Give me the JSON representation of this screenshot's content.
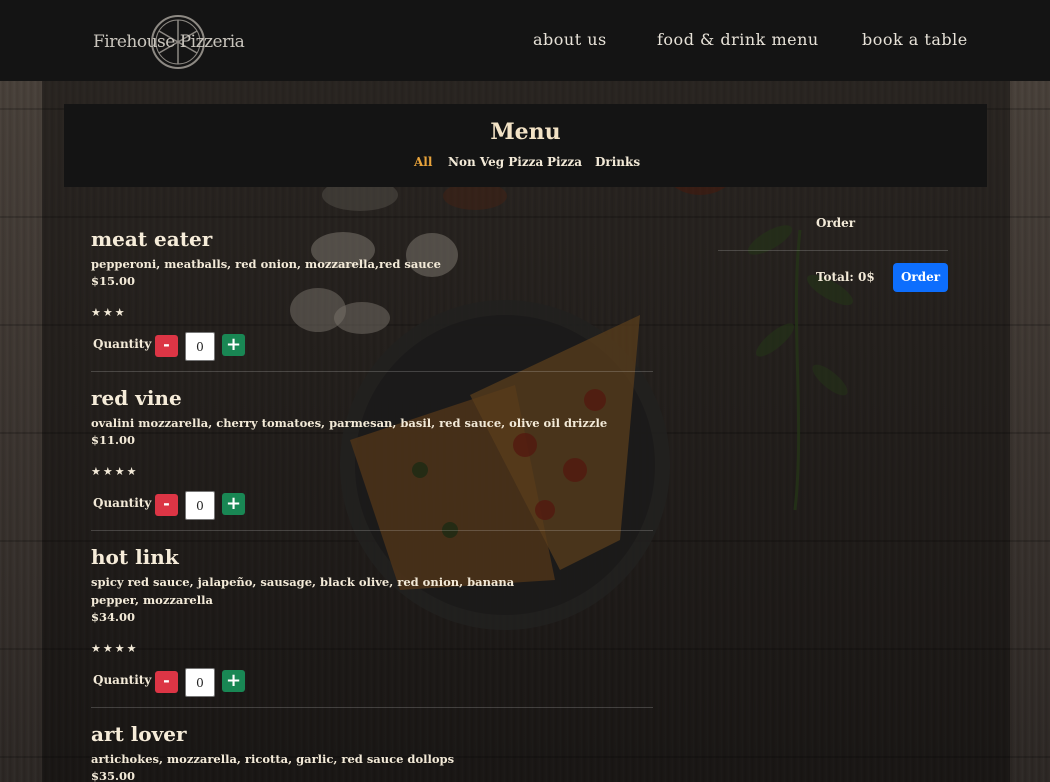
{
  "header": {
    "logo_text": "Firehouse Pizzeria",
    "nav": [
      {
        "label": "about us"
      },
      {
        "label": "food & drink menu"
      },
      {
        "label": "book a table"
      }
    ]
  },
  "menu": {
    "title": "Menu",
    "filters": [
      {
        "label": "All",
        "active": true
      },
      {
        "label": "Non Veg Pizza",
        "active": false
      },
      {
        "label": "Pizza",
        "active": false
      },
      {
        "label": "Drinks",
        "active": false
      }
    ],
    "quantity_label": "Quantity",
    "minus_symbol": "-",
    "plus_symbol": "+",
    "items": [
      {
        "name": "meat eater",
        "description": "pepperoni, meatballs, red onion, mozzarella,red sauce",
        "price": "$15.00",
        "stars": "★★★",
        "rating": 3,
        "quantity": "0"
      },
      {
        "name": "red vine",
        "description": "ovalini mozzarella, cherry tomatoes, parmesan, basil, red sauce, olive oil drizzle",
        "price": "$11.00",
        "stars": "★★★★",
        "rating": 4,
        "quantity": "0"
      },
      {
        "name": "hot link",
        "description": "spicy red sauce, jalapeño, sausage, black olive, red onion, banana pepper, mozzarella",
        "price": "$34.00",
        "stars": "★★★★",
        "rating": 4,
        "quantity": "0"
      },
      {
        "name": "art lover",
        "description": "artichokes, mozzarella, ricotta, garlic, red sauce dollops",
        "price": "$35.00"
      }
    ]
  },
  "order": {
    "title": "Order",
    "total": "Total: 0$",
    "button_label": "Order"
  },
  "colors": {
    "header_bg": "#141414",
    "active_filter": "#e8a33b",
    "minus_button": "#dc3545",
    "plus_button": "#198754",
    "order_button": "#0d6efd"
  }
}
